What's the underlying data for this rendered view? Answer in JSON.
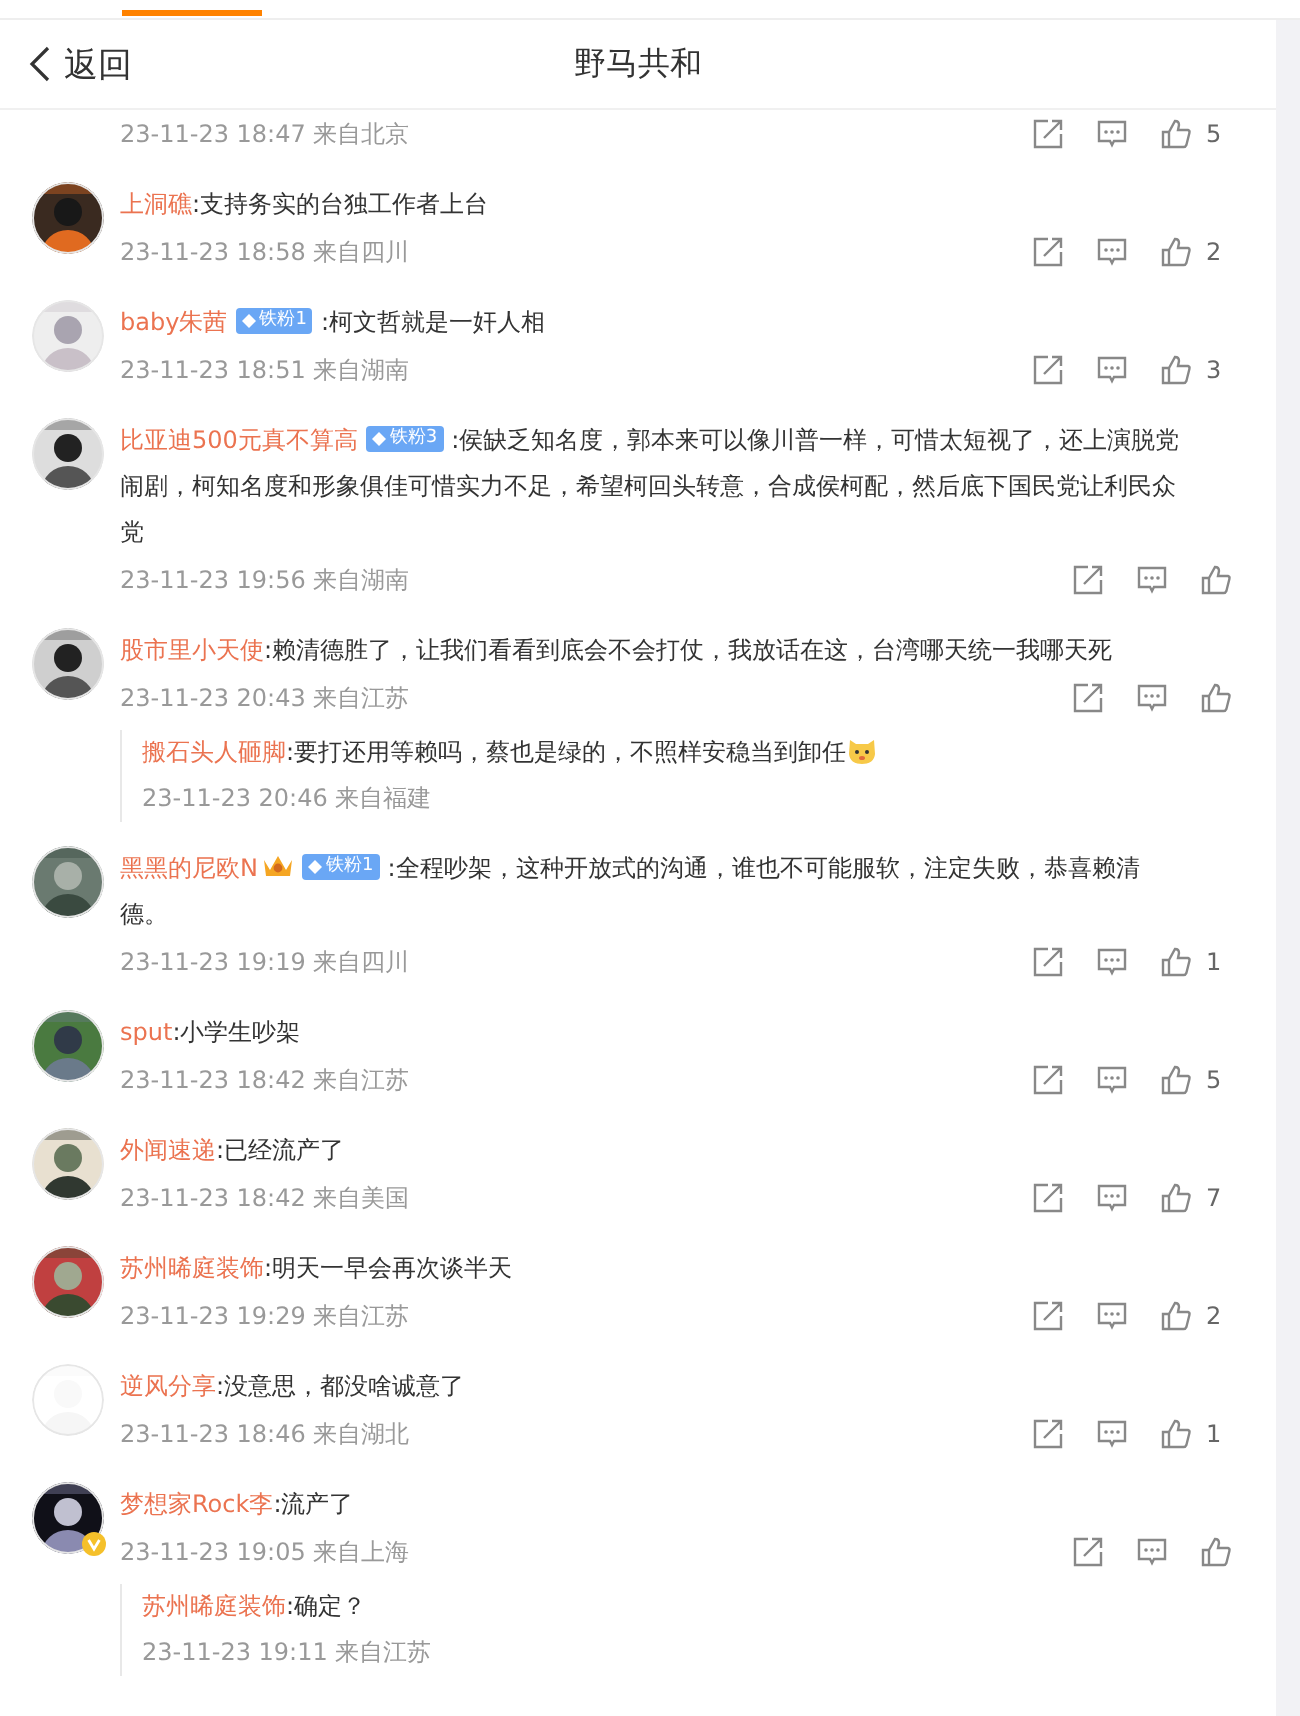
{
  "header": {
    "back_label": "返回",
    "title": "野马共和"
  },
  "comments": [
    {
      "meta": "23-11-23 18:47 来自北京",
      "likes": "5"
    },
    {
      "user": "上洞礁",
      "text": ":支持务实的台独工作者上台",
      "meta": "23-11-23 18:58 来自四川",
      "likes": "2"
    },
    {
      "user": "baby朱茜",
      "badge": "铁粉1",
      "text": ":柯文哲就是一奸人相",
      "meta": "23-11-23 18:51 来自湖南",
      "likes": "3"
    },
    {
      "user": "比亚迪500元真不算高",
      "badge": "铁粉3",
      "text": ":侯缺乏知名度，郭本来可以像川普一样，可惜太短视了，还上演脱党闹剧，柯知名度和形象俱佳可惜实力不足，希望柯回头转意，合成侯柯配，然后底下国民党让利民众党",
      "meta": "23-11-23 19:56 来自湖南"
    },
    {
      "user": "股市里小天使",
      "text": ":赖清德胜了，让我们看看到底会不会打仗，我放话在这，台湾哪天统一我哪天死",
      "meta": "23-11-23 20:43 来自江苏",
      "replies": [
        {
          "user": "搬石头人砸脚",
          "text": ":要打还用等赖吗，蔡也是绿的，不照样安稳当到卸任",
          "emoji": true,
          "meta": "23-11-23 20:46 来自福建"
        }
      ]
    },
    {
      "user": "黑黑的尼欧N",
      "crown": true,
      "badge": "铁粉1",
      "text": ":全程吵架，这种开放式的沟通，谁也不可能服软，注定失败，恭喜赖清德。",
      "meta": "23-11-23 19:19 来自四川",
      "likes": "1"
    },
    {
      "user": "sput",
      "text": ":小学生吵架",
      "meta": "23-11-23 18:42 来自江苏",
      "likes": "5"
    },
    {
      "user": "外闻速递",
      "text": ":已经流产了",
      "meta": "23-11-23 18:42 来自美国",
      "likes": "7"
    },
    {
      "user": "苏州晞庭装饰",
      "text": ":明天一早会再次谈半天",
      "meta": "23-11-23 19:29 来自江苏",
      "likes": "2"
    },
    {
      "user": "逆风分享",
      "text": ":没意思，都没啥诚意了",
      "meta": "23-11-23 18:46 来自湖北",
      "likes": "1"
    },
    {
      "user": "梦想家Rock李",
      "verified": true,
      "text": ":流产了",
      "meta": "23-11-23 19:05 来自上海",
      "replies": [
        {
          "user": "苏州晞庭装饰",
          "text": ":确定？",
          "meta": "23-11-23 19:11 来自江苏"
        }
      ]
    }
  ]
}
